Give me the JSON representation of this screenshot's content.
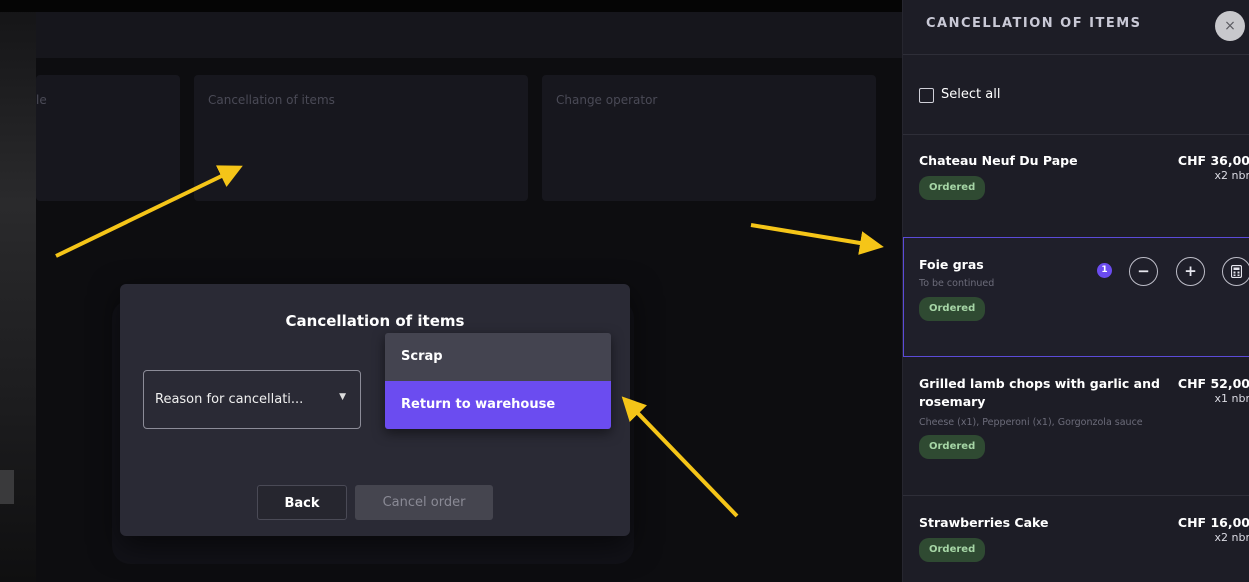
{
  "actions": {
    "card1_label": "le",
    "card2_label": "Cancellation of items",
    "card3_label": "Change operator"
  },
  "modal": {
    "title": "Cancellation of items",
    "reason_select": "Reason for cancellati...",
    "options": [
      "Scrap",
      "Return to warehouse"
    ],
    "highlighted_option": "Return to warehouse",
    "back_button": "Back",
    "cancel_order_button": "Cancel order"
  },
  "panel": {
    "title": "CANCELLATION OF ITEMS",
    "close_glyph": "×",
    "select_all": "Select all",
    "items": [
      {
        "name": "Chateau Neuf Du Pape",
        "price": "CHF 36,00",
        "qty": "x2 nbr",
        "status": "Ordered"
      },
      {
        "name": "Foie gras",
        "sub": "To be continued",
        "status": "Ordered",
        "count": "1",
        "minus": "−",
        "plus": "+"
      },
      {
        "name_line1": "Grilled lamb chops with garlic and",
        "name_line2": "rosemary",
        "price": "CHF 52,00",
        "qty": "x1 nbr",
        "sub": "Cheese (x1), Pepperoni (x1), Gorgonzola sauce",
        "status": "Ordered"
      },
      {
        "name": "Strawberries Cake",
        "price": "CHF 16,00",
        "qty": "x2 nbr",
        "status": "Ordered"
      }
    ]
  },
  "colors": {
    "accent": "#6b4cf0",
    "arrow": "#f5c518",
    "badge_bg": "#2f4a32",
    "panel_bg": "#1d1d26"
  },
  "icons": [
    "close-icon",
    "minus-icon",
    "plus-icon",
    "calculator-icon",
    "chevron-down-icon",
    "checkbox-icon"
  ]
}
